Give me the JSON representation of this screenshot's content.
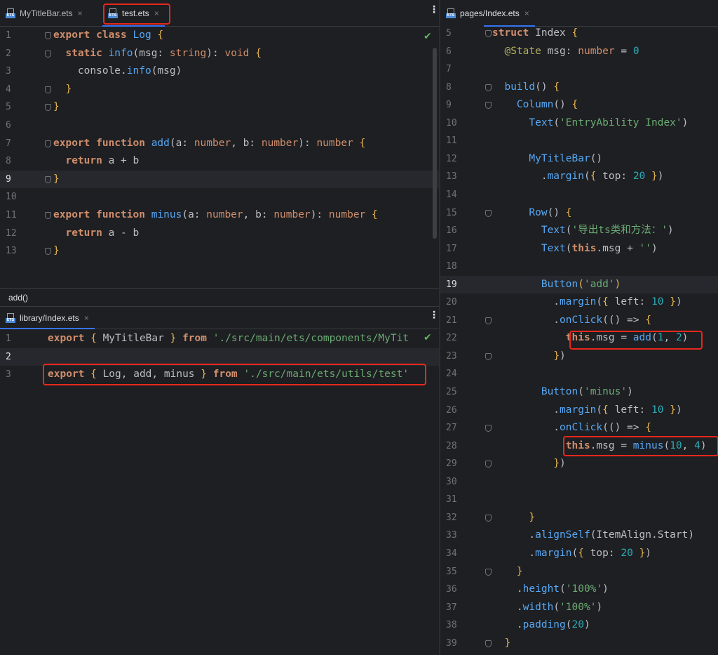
{
  "left_top": {
    "tabs": [
      {
        "label": "MyTitleBar.ets",
        "close": "×"
      },
      {
        "label": "test.ets",
        "close": "×"
      }
    ],
    "lines": [
      {
        "n": "1",
        "tokens": [
          [
            "kw",
            "export "
          ],
          [
            "kw",
            "class "
          ],
          [
            "fn",
            "Log "
          ],
          [
            "br",
            "{"
          ]
        ]
      },
      {
        "n": "2",
        "tokens": [
          [
            "p",
            "  "
          ],
          [
            "kw",
            "static "
          ],
          [
            "fn",
            "info"
          ],
          [
            "p",
            "(msg: "
          ],
          [
            "ty",
            "string"
          ],
          [
            "p",
            "): "
          ],
          [
            "ty",
            "void "
          ],
          [
            "br",
            "{"
          ]
        ]
      },
      {
        "n": "3",
        "tokens": [
          [
            "p",
            "    console."
          ],
          [
            "fn",
            "info"
          ],
          [
            "p",
            "(msg)"
          ]
        ]
      },
      {
        "n": "4",
        "tokens": [
          [
            "p",
            "  "
          ],
          [
            "br",
            "}"
          ]
        ]
      },
      {
        "n": "5",
        "tokens": [
          [
            "br",
            "}"
          ]
        ]
      },
      {
        "n": "6",
        "tokens": []
      },
      {
        "n": "7",
        "tokens": [
          [
            "kw",
            "export "
          ],
          [
            "kw",
            "function "
          ],
          [
            "fn",
            "add"
          ],
          [
            "p",
            "(a: "
          ],
          [
            "ty",
            "number"
          ],
          [
            "p",
            ", b: "
          ],
          [
            "ty",
            "number"
          ],
          [
            "p",
            "): "
          ],
          [
            "ty",
            "number "
          ],
          [
            "br",
            "{"
          ]
        ]
      },
      {
        "n": "8",
        "tokens": [
          [
            "p",
            "  "
          ],
          [
            "kw",
            "return "
          ],
          [
            "p",
            "a + b"
          ]
        ]
      },
      {
        "n": "9",
        "tokens": [
          [
            "br",
            "}"
          ]
        ]
      },
      {
        "n": "10",
        "tokens": []
      },
      {
        "n": "11",
        "tokens": [
          [
            "kw",
            "export "
          ],
          [
            "kw",
            "function "
          ],
          [
            "fn",
            "minus"
          ],
          [
            "p",
            "(a: "
          ],
          [
            "ty",
            "number"
          ],
          [
            "p",
            ", b: "
          ],
          [
            "ty",
            "number"
          ],
          [
            "p",
            "): "
          ],
          [
            "ty",
            "number "
          ],
          [
            "br",
            "{"
          ]
        ]
      },
      {
        "n": "12",
        "tokens": [
          [
            "p",
            "  "
          ],
          [
            "kw",
            "return "
          ],
          [
            "p",
            "a - b"
          ]
        ]
      },
      {
        "n": "13",
        "tokens": [
          [
            "br",
            "}"
          ]
        ]
      }
    ]
  },
  "status_text": "add()",
  "left_bottom": {
    "tabs": [
      {
        "label": "library/Index.ets",
        "close": "×"
      }
    ],
    "lines": [
      {
        "n": "1",
        "tokens": [
          [
            "kw",
            "export "
          ],
          [
            "br",
            "{ "
          ],
          [
            "p",
            "MyTitleBar "
          ],
          [
            "br",
            "} "
          ],
          [
            "kw",
            "from "
          ],
          [
            "st",
            "'./src/main/ets/components/MyTit"
          ]
        ]
      },
      {
        "n": "2",
        "tokens": []
      },
      {
        "n": "3",
        "tokens": [
          [
            "kw",
            "export "
          ],
          [
            "br",
            "{ "
          ],
          [
            "p",
            "Log, add, minus "
          ],
          [
            "br",
            "} "
          ],
          [
            "kw",
            "from "
          ],
          [
            "st",
            "'./src/main/ets/utils/test'"
          ]
        ]
      }
    ]
  },
  "right": {
    "tabs": [
      {
        "label": "pages/Index.ets",
        "close": "×"
      }
    ],
    "lines": [
      {
        "n": "5",
        "tokens": [
          [
            "kw",
            "struct "
          ],
          [
            "p",
            "Index "
          ],
          [
            "br",
            "{"
          ]
        ]
      },
      {
        "n": "6",
        "tokens": [
          [
            "p",
            "  "
          ],
          [
            "an",
            "@State "
          ],
          [
            "p",
            "msg: "
          ],
          [
            "ty",
            "number "
          ],
          [
            "p",
            "= "
          ],
          [
            "nm",
            "0"
          ]
        ]
      },
      {
        "n": "7",
        "tokens": []
      },
      {
        "n": "8",
        "tokens": [
          [
            "p",
            "  "
          ],
          [
            "mt",
            "build"
          ],
          [
            "p",
            "() "
          ],
          [
            "br",
            "{"
          ]
        ]
      },
      {
        "n": "9",
        "tokens": [
          [
            "p",
            "    "
          ],
          [
            "mt",
            "Column"
          ],
          [
            "p",
            "() "
          ],
          [
            "br",
            "{"
          ]
        ]
      },
      {
        "n": "10",
        "tokens": [
          [
            "p",
            "      "
          ],
          [
            "mt",
            "Text"
          ],
          [
            "p",
            "("
          ],
          [
            "st",
            "'EntryAbility Index'"
          ],
          [
            "p",
            ")"
          ]
        ]
      },
      {
        "n": "11",
        "tokens": []
      },
      {
        "n": "12",
        "tokens": [
          [
            "p",
            "      "
          ],
          [
            "mt",
            "MyTitleBar"
          ],
          [
            "p",
            "()"
          ]
        ]
      },
      {
        "n": "13",
        "tokens": [
          [
            "p",
            "        ."
          ],
          [
            "fn",
            "margin"
          ],
          [
            "p",
            "("
          ],
          [
            "br",
            "{ "
          ],
          [
            "p",
            "top: "
          ],
          [
            "nm",
            "20 "
          ],
          [
            "br",
            "}"
          ],
          [
            "p",
            ")"
          ]
        ]
      },
      {
        "n": "14",
        "tokens": []
      },
      {
        "n": "15",
        "tokens": [
          [
            "p",
            "      "
          ],
          [
            "mt",
            "Row"
          ],
          [
            "p",
            "() "
          ],
          [
            "br",
            "{"
          ]
        ]
      },
      {
        "n": "16",
        "tokens": [
          [
            "p",
            "        "
          ],
          [
            "mt",
            "Text"
          ],
          [
            "p",
            "("
          ],
          [
            "st",
            "'导出ts类和方法：'"
          ],
          [
            "p",
            ")"
          ]
        ]
      },
      {
        "n": "17",
        "tokens": [
          [
            "p",
            "        "
          ],
          [
            "mt",
            "Text"
          ],
          [
            "p",
            "("
          ],
          [
            "kw",
            "this"
          ],
          [
            "p",
            ".msg + "
          ],
          [
            "st",
            "''"
          ],
          [
            "p",
            ")"
          ]
        ]
      },
      {
        "n": "18",
        "tokens": []
      },
      {
        "n": "19",
        "tokens": [
          [
            "p",
            "        "
          ],
          [
            "mt",
            "Button"
          ],
          [
            "br",
            "("
          ],
          [
            "st",
            "'add'"
          ],
          [
            "br",
            ")"
          ]
        ]
      },
      {
        "n": "20",
        "tokens": [
          [
            "p",
            "          ."
          ],
          [
            "fn",
            "margin"
          ],
          [
            "p",
            "("
          ],
          [
            "br",
            "{ "
          ],
          [
            "p",
            "left: "
          ],
          [
            "nm",
            "10 "
          ],
          [
            "br",
            "}"
          ],
          [
            "p",
            ")"
          ]
        ]
      },
      {
        "n": "21",
        "tokens": [
          [
            "p",
            "          ."
          ],
          [
            "fn",
            "onClick"
          ],
          [
            "p",
            "(() => "
          ],
          [
            "br",
            "{"
          ]
        ]
      },
      {
        "n": "22",
        "tokens": [
          [
            "p",
            "            "
          ],
          [
            "kw",
            "this"
          ],
          [
            "p",
            ".msg = "
          ],
          [
            "fn",
            "add"
          ],
          [
            "p",
            "("
          ],
          [
            "nm",
            "1"
          ],
          [
            "p",
            ", "
          ],
          [
            "nm",
            "2"
          ],
          [
            "p",
            ")"
          ]
        ]
      },
      {
        "n": "23",
        "tokens": [
          [
            "p",
            "          "
          ],
          [
            "br",
            "}"
          ],
          [
            "p",
            ")"
          ]
        ]
      },
      {
        "n": "24",
        "tokens": []
      },
      {
        "n": "25",
        "tokens": [
          [
            "p",
            "        "
          ],
          [
            "mt",
            "Button"
          ],
          [
            "p",
            "("
          ],
          [
            "st",
            "'minus'"
          ],
          [
            "p",
            ")"
          ]
        ]
      },
      {
        "n": "26",
        "tokens": [
          [
            "p",
            "          ."
          ],
          [
            "fn",
            "margin"
          ],
          [
            "p",
            "("
          ],
          [
            "br",
            "{ "
          ],
          [
            "p",
            "left: "
          ],
          [
            "nm",
            "10 "
          ],
          [
            "br",
            "}"
          ],
          [
            "p",
            ")"
          ]
        ]
      },
      {
        "n": "27",
        "tokens": [
          [
            "p",
            "          ."
          ],
          [
            "fn",
            "onClick"
          ],
          [
            "p",
            "(() => "
          ],
          [
            "br",
            "{"
          ]
        ]
      },
      {
        "n": "28",
        "tokens": [
          [
            "p",
            "            "
          ],
          [
            "kw",
            "this"
          ],
          [
            "p",
            ".msg = "
          ],
          [
            "fn",
            "minus"
          ],
          [
            "p",
            "("
          ],
          [
            "nm",
            "10"
          ],
          [
            "p",
            ", "
          ],
          [
            "nm",
            "4"
          ],
          [
            "p",
            ")"
          ]
        ]
      },
      {
        "n": "29",
        "tokens": [
          [
            "p",
            "          "
          ],
          [
            "br",
            "}"
          ],
          [
            "p",
            ")"
          ]
        ]
      },
      {
        "n": "30",
        "tokens": []
      },
      {
        "n": "31",
        "tokens": []
      },
      {
        "n": "32",
        "tokens": [
          [
            "p",
            "      "
          ],
          [
            "br",
            "}"
          ]
        ]
      },
      {
        "n": "33",
        "tokens": [
          [
            "p",
            "      ."
          ],
          [
            "fn",
            "alignSelf"
          ],
          [
            "p",
            "(ItemAlign.Start)"
          ]
        ]
      },
      {
        "n": "34",
        "tokens": [
          [
            "p",
            "      ."
          ],
          [
            "fn",
            "margin"
          ],
          [
            "p",
            "("
          ],
          [
            "br",
            "{ "
          ],
          [
            "p",
            "top: "
          ],
          [
            "nm",
            "20 "
          ],
          [
            "br",
            "}"
          ],
          [
            "p",
            ")"
          ]
        ]
      },
      {
        "n": "35",
        "tokens": [
          [
            "p",
            "    "
          ],
          [
            "br",
            "}"
          ]
        ]
      },
      {
        "n": "36",
        "tokens": [
          [
            "p",
            "    ."
          ],
          [
            "fn",
            "height"
          ],
          [
            "p",
            "("
          ],
          [
            "st",
            "'100%'"
          ],
          [
            "p",
            ")"
          ]
        ]
      },
      {
        "n": "37",
        "tokens": [
          [
            "p",
            "    ."
          ],
          [
            "fn",
            "width"
          ],
          [
            "p",
            "("
          ],
          [
            "st",
            "'100%'"
          ],
          [
            "p",
            ")"
          ]
        ]
      },
      {
        "n": "38",
        "tokens": [
          [
            "p",
            "    ."
          ],
          [
            "fn",
            "padding"
          ],
          [
            "p",
            "("
          ],
          [
            "nm",
            "20"
          ],
          [
            "p",
            ")"
          ]
        ]
      },
      {
        "n": "39",
        "tokens": [
          [
            "p",
            "  "
          ],
          [
            "br",
            "}"
          ]
        ]
      }
    ]
  },
  "icons": {
    "file_type": "ETS",
    "more_icon": "⋮",
    "check_icon": "✔"
  },
  "colors": {
    "highlight_box": "#e8281b",
    "tab_active": "#3574f0",
    "background": "#1e1f22"
  }
}
